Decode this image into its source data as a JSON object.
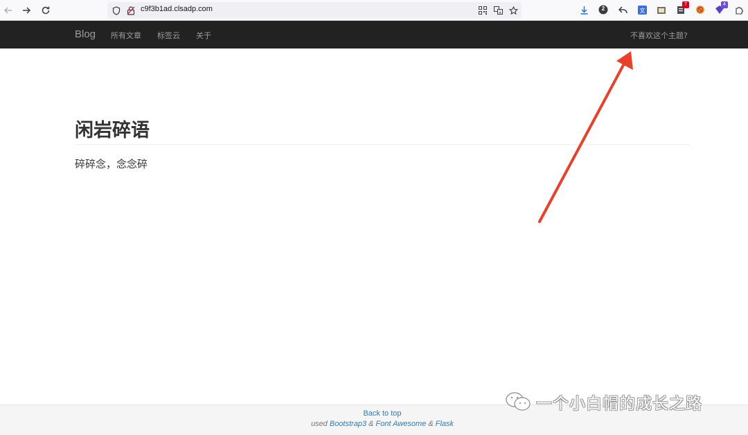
{
  "browser": {
    "url": "c9f3b1ad.clsadp.com",
    "extension_badges": {
      "ext_a": "2",
      "ext_b": "7",
      "ext_c": "4"
    }
  },
  "navbar": {
    "brand": "Blog",
    "links": [
      "所有文章",
      "标签云",
      "关于"
    ],
    "right_link": "不喜欢这个主题?"
  },
  "main": {
    "title": "闲岩碎语",
    "subtitle": "碎碎念，念念碎"
  },
  "footer": {
    "back_to_top": "Back to top",
    "used_prefix": "used",
    "tech": [
      "Bootstrap3",
      "Font Awesome",
      "Flask"
    ],
    "separator": "&"
  },
  "watermark": {
    "text": "一个小白帽的成长之路"
  },
  "colors": {
    "navbar_bg": "#222222",
    "navbar_text": "#9d9d9d",
    "link": "#337ab7",
    "annotation_arrow": "#e8402a"
  }
}
